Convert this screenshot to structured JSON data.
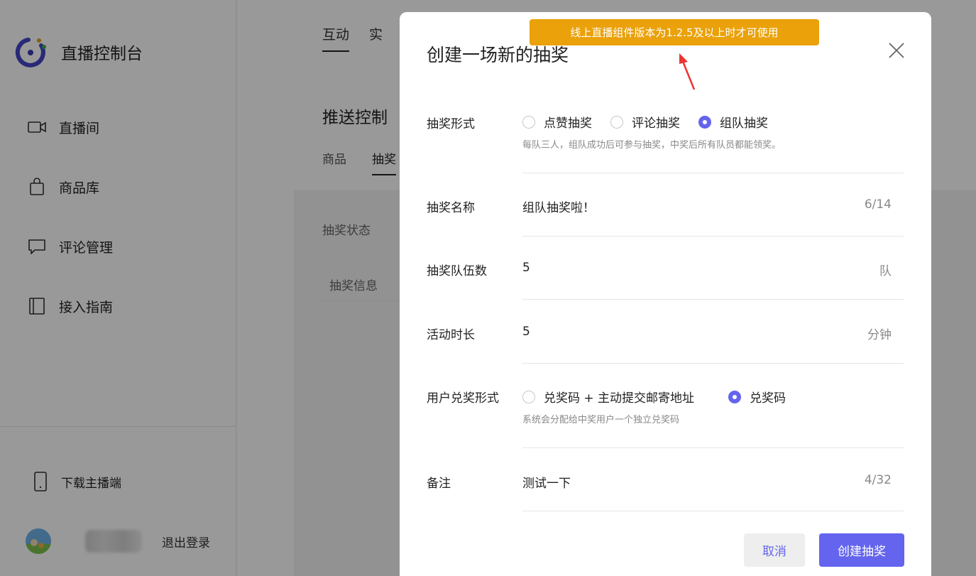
{
  "app": {
    "title": "直播控制台"
  },
  "sidebar": {
    "items": [
      {
        "label": "直播间",
        "icon": "video-icon"
      },
      {
        "label": "商品库",
        "icon": "bag-icon"
      },
      {
        "label": "评论管理",
        "icon": "comment-icon"
      },
      {
        "label": "接入指南",
        "icon": "book-icon"
      }
    ],
    "download_label": "下载主播端",
    "logout_label": "退出登录"
  },
  "main": {
    "tabs": [
      {
        "label": "互动"
      },
      {
        "label": "实"
      }
    ],
    "card_title": "推送控制",
    "sub_tabs": [
      {
        "label": "商品"
      },
      {
        "label": "抽奖"
      }
    ],
    "status_label": "抽奖状态",
    "info_label": "抽奖信息"
  },
  "banner": {
    "text": "线上直播组件版本为1.2.5及以上时才可使用"
  },
  "modal": {
    "title": "创建一场新的抽奖",
    "lottery_form": {
      "label": "抽奖形式",
      "options": [
        "点赞抽奖",
        "评论抽奖",
        "组队抽奖"
      ],
      "selected": "组队抽奖",
      "hint": "每队三人，组队成功后可参与抽奖，中奖后所有队员都能领奖。"
    },
    "name": {
      "label": "抽奖名称",
      "value": "组队抽奖啦！",
      "counter": "6/14"
    },
    "teams": {
      "label": "抽奖队伍数",
      "value": "5",
      "unit": "队"
    },
    "duration": {
      "label": "活动时长",
      "value": "5",
      "unit": "分钟"
    },
    "redeem": {
      "label": "用户兑奖形式",
      "options": [
        "兑奖码 + 主动提交邮寄地址",
        "兑奖码"
      ],
      "selected": "兑奖码",
      "hint": "系统会分配给中奖用户一个独立兑奖码"
    },
    "remark": {
      "label": "备注",
      "value": "测试一下",
      "counter": "4/32"
    },
    "cancel_label": "取消",
    "create_label": "创建抽奖"
  },
  "colors": {
    "accent": "#6464ee",
    "banner": "#eaa10a",
    "arrow": "#ee3333"
  }
}
